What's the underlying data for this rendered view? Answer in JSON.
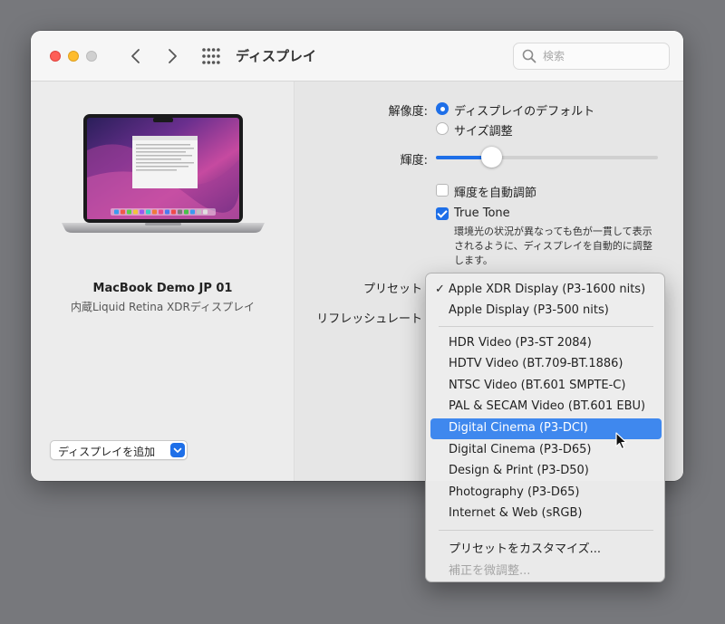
{
  "window": {
    "title": "ディスプレイ",
    "search_placeholder": "検索"
  },
  "left": {
    "device_name": "MacBook Demo JP 01",
    "device_subtitle": "内蔵Liquid Retina XDRディスプレイ",
    "add_display_label": "ディスプレイを追加"
  },
  "right": {
    "resolution_label": "解像度:",
    "resolution_options": [
      "ディスプレイのデフォルト",
      "サイズ調整"
    ],
    "resolution_selected": "ディスプレイのデフォルト",
    "brightness_label": "輝度:",
    "brightness_level": 0.25,
    "auto_brightness_label": "輝度を自動調節",
    "auto_brightness_checked": false,
    "true_tone_label": "True Tone",
    "true_tone_checked": true,
    "true_tone_desc": "環境光の状況が異なっても色が一貫して表示されるように、ディスプレイを自動的に調整します。",
    "preset_label": "プリセット",
    "refresh_label": "リフレッシュレート"
  },
  "menu": {
    "checked_item": "Apple XDR Display (P3-1600 nits)",
    "highlighted_item": "Digital Cinema (P3-DCI)",
    "group1": [
      "Apple XDR Display (P3-1600 nits)",
      "Apple Display (P3-500 nits)"
    ],
    "group2": [
      "HDR Video (P3-ST 2084)",
      "HDTV Video (BT.709-BT.1886)",
      "NTSC Video (BT.601 SMPTE-C)",
      "PAL & SECAM Video (BT.601 EBU)",
      "Digital Cinema (P3-DCI)",
      "Digital Cinema (P3-D65)",
      "Design & Print (P3-D50)",
      "Photography (P3-D65)",
      "Internet & Web (sRGB)"
    ],
    "customize": "プリセットをカスタマイズ...",
    "fine_tune": "補正を微調整..."
  },
  "colors": {
    "accent": "#1e6fe8",
    "selection": "#3f88ee"
  }
}
